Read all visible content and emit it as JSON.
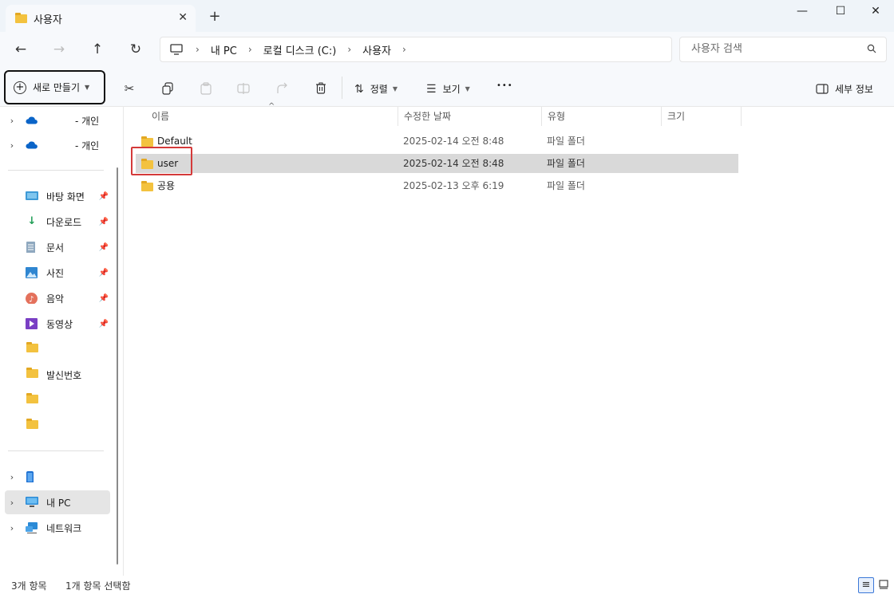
{
  "window": {
    "tab_title": "사용자",
    "new_tab": "+",
    "close_tab": "✕",
    "minimize": "—",
    "maximize": "☐",
    "close": "✕"
  },
  "nav": {
    "back": "←",
    "forward": "→",
    "up": "↑",
    "refresh": "↻",
    "breadcrumb": [
      "내 PC",
      "로컬 디스크 (C:)",
      "사용자"
    ],
    "search_placeholder": "사용자 검색"
  },
  "toolbar": {
    "new_label": "새로 만들기",
    "sort_label": "정렬",
    "view_label": "보기",
    "more": "•••",
    "details_label": "세부 정보"
  },
  "sidebar": {
    "cloud_items": [
      {
        "label": "- 개인"
      },
      {
        "label": "- 개인"
      }
    ],
    "quick_access": [
      {
        "label": "바탕 화면",
        "icon": "desktop-icon"
      },
      {
        "label": "다운로드",
        "icon": "download-icon"
      },
      {
        "label": "문서",
        "icon": "document-icon"
      },
      {
        "label": "사진",
        "icon": "pictures-icon"
      },
      {
        "label": "음악",
        "icon": "music-icon"
      },
      {
        "label": "동영상",
        "icon": "video-icon"
      },
      {
        "label": "",
        "icon": "folder-icon"
      },
      {
        "label": "발신번호",
        "icon": "folder-icon"
      },
      {
        "label": "",
        "icon": "folder-icon"
      },
      {
        "label": "",
        "icon": "folder-icon"
      }
    ],
    "devices": [
      {
        "label": "",
        "icon": "phone-icon"
      },
      {
        "label": "내 PC",
        "icon": "pc-icon"
      },
      {
        "label": "네트워크",
        "icon": "network-icon"
      }
    ]
  },
  "columns": [
    "이름",
    "수정한 날짜",
    "유형",
    "크기"
  ],
  "rows": [
    {
      "name": "Default",
      "date": "2025-02-14 오전 8:48",
      "type": "파일 폴더",
      "size": ""
    },
    {
      "name": "user",
      "date": "2025-02-14 오전 8:48",
      "type": "파일 폴더",
      "size": ""
    },
    {
      "name": "공용",
      "date": "2025-02-13 오후 6:19",
      "type": "파일 폴더",
      "size": ""
    }
  ],
  "status": {
    "count": "3개 항목",
    "selected": "1개 항목 선택함"
  },
  "colors": {
    "accent": "#3b78d8",
    "highlight_box": "#d43a3a",
    "folder": "#f3c23f"
  }
}
